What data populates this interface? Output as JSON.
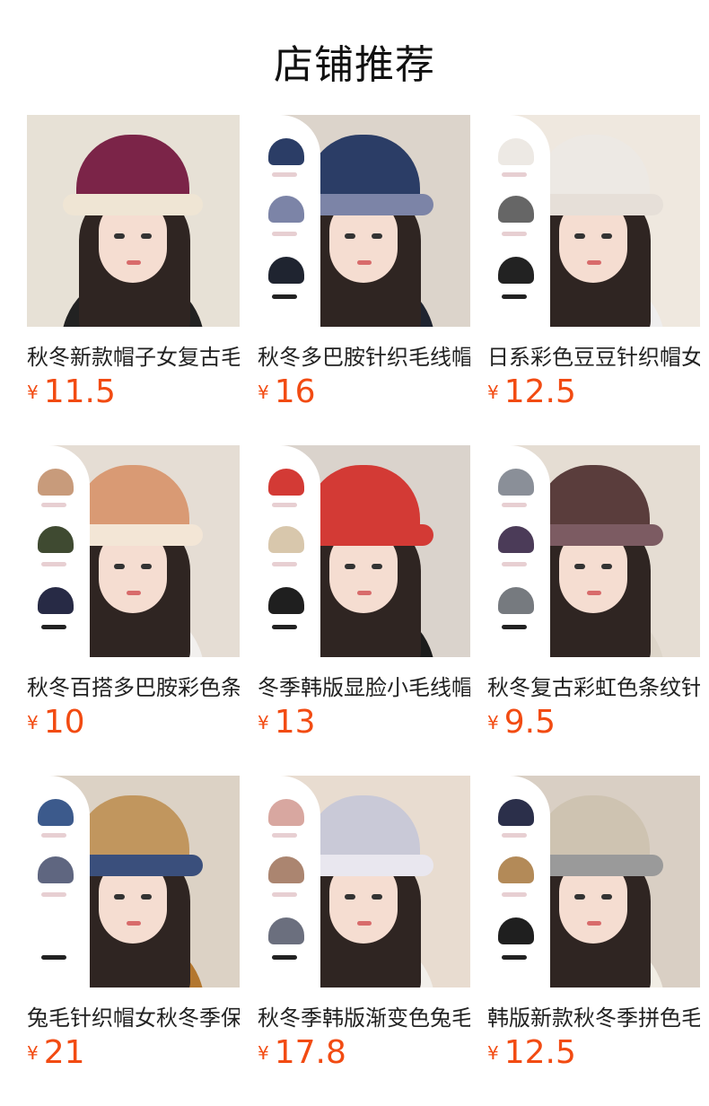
{
  "header": {
    "title": "店铺推荐"
  },
  "products": [
    {
      "name": "秋冬新款帽子女复古毛线帽",
      "currency": "¥",
      "price": "11.5",
      "colors": {
        "bg": "#e7e1d6",
        "hat": "#7b2448",
        "brim": "#efe5d4",
        "body": "#222222"
      },
      "thumbs": false
    },
    {
      "name": "秋冬多巴胺针织毛线帽女",
      "currency": "¥",
      "price": "16",
      "colors": {
        "bg": "#dcd4cb",
        "hat": "#2b3d66",
        "brim": "#7c84a7",
        "body": "#1f2430"
      },
      "thumbs": true
    },
    {
      "name": "日系彩色豆豆针织帽女",
      "currency": "¥",
      "price": "12.5",
      "colors": {
        "bg": "#efe8df",
        "hat": "#ede9e4",
        "brim": "#e6dfd8",
        "body": "#efeeee"
      },
      "thumbs": true
    },
    {
      "name": "秋冬百搭多巴胺彩色条纹帽",
      "currency": "¥",
      "price": "10",
      "colors": {
        "bg": "#e5ddd4",
        "hat": "#d99a74",
        "brim": "#f3e6d6",
        "body": "#f2f0ee"
      },
      "thumbs": true
    },
    {
      "name": "冬季韩版显脸小毛线帽女",
      "currency": "¥",
      "price": "13",
      "colors": {
        "bg": "#dad3cc",
        "hat": "#d33a35",
        "brim": "#d33a35",
        "body": "#1c1c1c"
      },
      "thumbs": true
    },
    {
      "name": "秋冬复古彩虹色条纹针织帽",
      "currency": "¥",
      "price": "9.5",
      "colors": {
        "bg": "#e5ddd3",
        "hat": "#5a3d3c",
        "brim": "#7c5b62",
        "body": "#ddd5c9"
      },
      "thumbs": true
    },
    {
      "name": "兔毛针织帽女秋冬季保暖",
      "currency": "¥",
      "price": "21",
      "colors": {
        "bg": "#dcd2c5",
        "hat": "#c1965e",
        "brim": "#3a4f7c",
        "body": "#b3772f"
      },
      "thumbs": true
    },
    {
      "name": "秋冬季韩版渐变色兔毛帽",
      "currency": "¥",
      "price": "17.8",
      "colors": {
        "bg": "#e8dcd0",
        "hat": "#c9c9d7",
        "brim": "#e9e7ef",
        "body": "#f2efea"
      },
      "thumbs": true
    },
    {
      "name": "韩版新款秋冬季拼色毛线帽",
      "currency": "¥",
      "price": "12.5",
      "colors": {
        "bg": "#d9cfc4",
        "hat": "#cec3b1",
        "brim": "#9a9a9a",
        "body": "#f1ede4"
      },
      "thumbs": true
    }
  ]
}
